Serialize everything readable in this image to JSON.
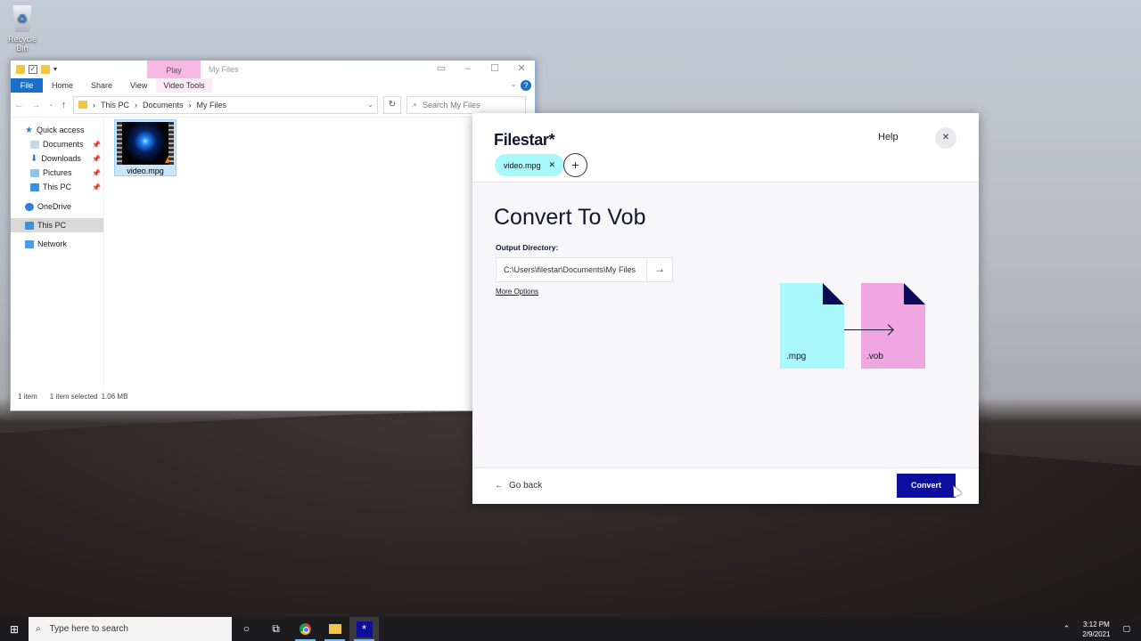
{
  "desktop": {
    "recycle_bin_label": "Recycle Bin"
  },
  "explorer": {
    "title": "My Files",
    "play_tab": "Play",
    "ribbon": {
      "file": "File",
      "home": "Home",
      "share": "Share",
      "view": "View",
      "video_tools": "Video Tools"
    },
    "address": {
      "crumbs": [
        "This PC",
        "Documents",
        "My Files"
      ],
      "search_placeholder": "Search My Files"
    },
    "nav": {
      "quick_access": "Quick access",
      "documents": "Documents",
      "downloads": "Downloads",
      "pictures": "Pictures",
      "this_pc_pinned": "This PC",
      "onedrive": "OneDrive",
      "this_pc": "This PC",
      "network": "Network"
    },
    "files": [
      {
        "name": "video.mpg"
      }
    ],
    "status": {
      "count": "1 item",
      "selected": "1 item selected",
      "size": "1.06 MB"
    }
  },
  "filestar": {
    "logo": "Filestar*",
    "help": "Help",
    "chip_label": "video.mpg",
    "title": "Convert To Vob",
    "output_label": "Output Directory:",
    "output_path": "C:\\Users\\filestar\\Documents\\My Files",
    "more_options": "More Options",
    "source_ext": ".mpg",
    "target_ext": ".vob",
    "back_label": "Go back",
    "convert_label": "Convert",
    "colors": {
      "source": "#a8f8fb",
      "target": "#f0a6e0",
      "accent": "#0d0d9e"
    }
  },
  "taskbar": {
    "search_placeholder": "Type here to search",
    "time": "3:12 PM",
    "date": "2/9/2021"
  }
}
